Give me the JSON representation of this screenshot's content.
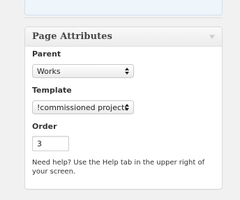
{
  "metabox": {
    "title": "Page Attributes",
    "parent": {
      "label": "Parent",
      "value": "Works"
    },
    "template": {
      "label": "Template",
      "value": "!commissioned projects"
    },
    "order": {
      "label": "Order",
      "value": "3"
    },
    "help_text": "Need help? Use the Help tab in the upper right of your screen."
  },
  "icons": {
    "toggle": "chevron-down-icon",
    "select_arrows": "updown-arrows-icon"
  }
}
